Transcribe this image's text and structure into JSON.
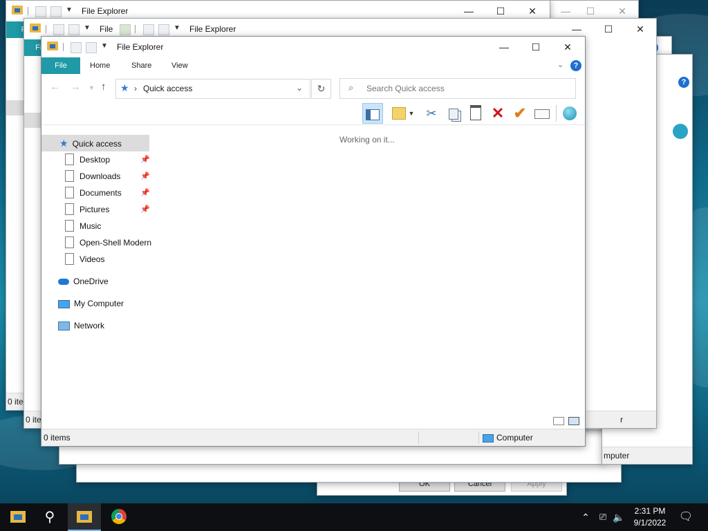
{
  "background_windows": [
    {
      "title": "File Explorer",
      "file_tab": "File"
    },
    {
      "title": "File Explorer",
      "file_tab": "File"
    },
    {
      "title": "File",
      "file_tab": "F"
    }
  ],
  "bg_fragments": {
    "status_items_1": "0 ite",
    "status_items_2": "0 ite",
    "status_computer_fragment": "mputer",
    "status_r_fragment": "r",
    "ok": "OK",
    "cancel": "Cancel",
    "apply": "Apply"
  },
  "window": {
    "title": "File Explorer",
    "controls": {
      "minimize": "—",
      "maximize": "☐",
      "close": "✕"
    },
    "ribbon_tabs": [
      "File",
      "Home",
      "Share",
      "View"
    ],
    "address": {
      "separator": "›",
      "location": "Quick access"
    },
    "search_placeholder": "Search Quick access",
    "content_status": "Working on it...",
    "nav": {
      "quick_access": "Quick access",
      "pinned": [
        {
          "label": "Desktop",
          "pinned": true
        },
        {
          "label": "Downloads",
          "pinned": true
        },
        {
          "label": "Documents",
          "pinned": true
        },
        {
          "label": "Pictures",
          "pinned": true
        },
        {
          "label": "Music",
          "pinned": false
        },
        {
          "label": "Open-Shell Modern",
          "pinned": false
        },
        {
          "label": "Videos",
          "pinned": false
        }
      ],
      "onedrive": "OneDrive",
      "my_computer": "My Computer",
      "network": "Network"
    },
    "statusbar": {
      "items": "0 items",
      "location": "Computer"
    }
  },
  "taskbar": {
    "time": "2:31 PM",
    "date": "9/1/2022"
  },
  "colors": {
    "file_tab": "#1f9aa6",
    "accent": "#77b7ff",
    "taskbar": "#0d0f12",
    "delete_red": "#d0121b",
    "check_orange": "#e07b1a"
  }
}
